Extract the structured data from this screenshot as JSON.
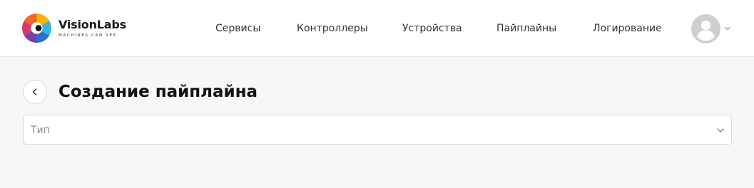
{
  "brand": {
    "name": "VisionLabs",
    "tagline": "MACHINES CAN SEE"
  },
  "nav": {
    "items": [
      {
        "label": "Сервисы"
      },
      {
        "label": "Контроллеры"
      },
      {
        "label": "Устройства"
      },
      {
        "label": "Пайплайны"
      },
      {
        "label": "Логирование"
      }
    ]
  },
  "user_menu": {
    "avatar_icon": "user-avatar-icon",
    "chevron_icon": "chevron-down-icon"
  },
  "page": {
    "back_icon": "chevron-left-icon",
    "title": "Создание пайплайна"
  },
  "form": {
    "type_select": {
      "placeholder": "Тип",
      "value": ""
    }
  },
  "colors": {
    "header_background": "#ffffff",
    "page_background": "#f7f7f7",
    "border": "#d9d9d9",
    "avatar_gray": "#cfcfcf"
  }
}
